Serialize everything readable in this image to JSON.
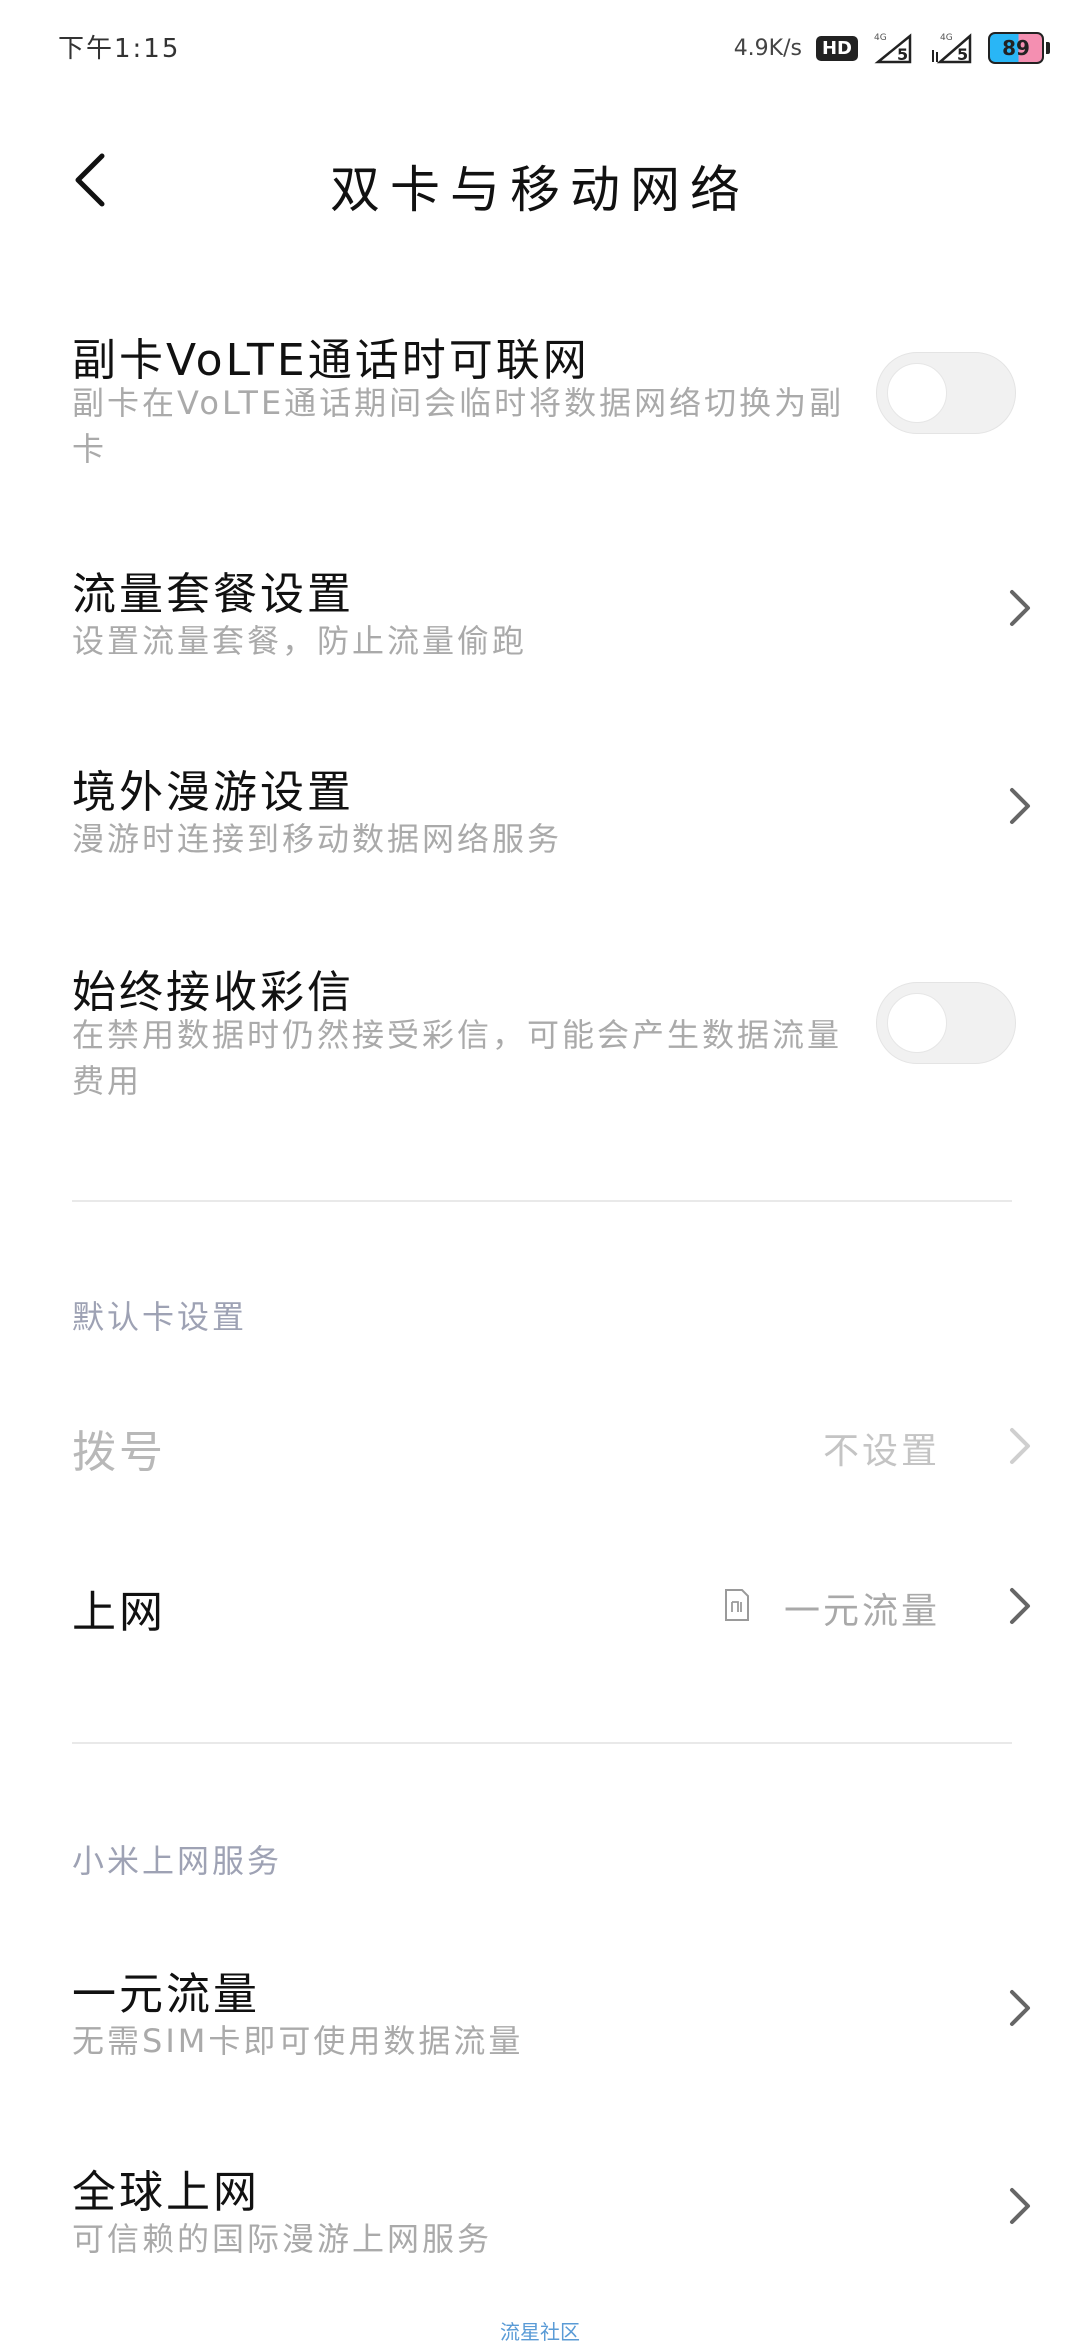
{
  "status_bar": {
    "time": "下午1:15",
    "net_speed": "4.9K/s",
    "hd": "HD",
    "sim1_label": "4G",
    "sim1_level": "5",
    "sim2_label": "4G",
    "sim2_level": "5",
    "battery": "89"
  },
  "header": {
    "title": "双卡与移动网络"
  },
  "settings": {
    "volte_data": {
      "title": "副卡VoLTE通话时可联网",
      "subtitle": "副卡在VoLTE通话期间会临时将数据网络切换为副卡",
      "enabled": false
    },
    "data_plan": {
      "title": "流量套餐设置",
      "subtitle": "设置流量套餐，防止流量偷跑"
    },
    "roaming": {
      "title": "境外漫游设置",
      "subtitle": "漫游时连接到移动数据网络服务"
    },
    "mms": {
      "title": "始终接收彩信",
      "subtitle": "在禁用数据时仍然接受彩信，可能会产生数据流量费用",
      "enabled": false
    }
  },
  "default_card": {
    "header": "默认卡设置",
    "dial": {
      "label": "拨号",
      "value": "不设置"
    },
    "internet": {
      "label": "上网",
      "value": "一元流量"
    }
  },
  "xiaomi_service": {
    "header": "小米上网服务",
    "one_yuan": {
      "title": "一元流量",
      "subtitle": "无需SIM卡即可使用数据流量"
    },
    "global": {
      "title": "全球上网",
      "subtitle": "可信赖的国际漫游上网服务"
    }
  },
  "footer": {
    "watermark": "流星社区"
  },
  "colors": {
    "text_primary": "#111111",
    "text_secondary": "#aaaaaa",
    "section_header": "#9ea2b4",
    "divider": "#e9e9e9",
    "toggle_off": "#f1f1f1"
  }
}
